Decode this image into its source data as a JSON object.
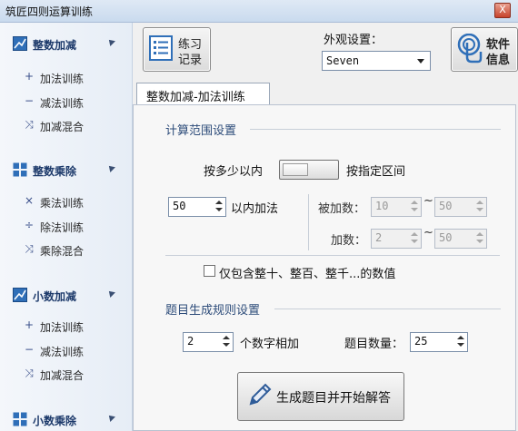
{
  "window": {
    "title": "筑匠四则运算训练",
    "close_label": "X"
  },
  "sidebar": {
    "groups": [
      {
        "label": "整数加减",
        "items": [
          {
            "icon": "plus-icon",
            "glyph": "+",
            "label": "加法训练"
          },
          {
            "icon": "minus-icon",
            "glyph": "−",
            "label": "减法训练"
          },
          {
            "icon": "shuffle-icon",
            "glyph": "⤨",
            "label": "加减混合"
          }
        ]
      },
      {
        "label": "整数乘除",
        "items": [
          {
            "icon": "multiply-icon",
            "glyph": "×",
            "label": "乘法训练"
          },
          {
            "icon": "divide-icon",
            "glyph": "÷",
            "label": "除法训练"
          },
          {
            "icon": "shuffle-icon",
            "glyph": "⤨",
            "label": "乘除混合"
          }
        ]
      },
      {
        "label": "小数加减",
        "items": [
          {
            "icon": "plus-icon",
            "glyph": "+",
            "label": "加法训练"
          },
          {
            "icon": "minus-icon",
            "glyph": "−",
            "label": "减法训练"
          },
          {
            "icon": "shuffle-icon",
            "glyph": "⤨",
            "label": "加减混合"
          }
        ]
      },
      {
        "label": "小数乘除",
        "items": []
      }
    ]
  },
  "toolbar": {
    "practice_record_line1": "练习",
    "practice_record_line2": "记录",
    "appearance_label": "外观设置：",
    "theme_value": "Seven",
    "software_info_line1": "软件",
    "software_info_line2": "信息"
  },
  "tab": {
    "label": "整数加减-加法训练"
  },
  "range": {
    "section_title": "计算范围设置",
    "mode_left_label": "按多少以内",
    "mode_right_label": "按指定区间",
    "within_value": "50",
    "within_label": "以内加法",
    "augend_label": "被加数：",
    "augend_min": "10",
    "augend_max": "50",
    "addend_label": "加数：",
    "addend_min": "2",
    "addend_max": "50",
    "range_sep": "~",
    "only_whole_label": "仅包含整十、整百、整千...的数值"
  },
  "rules": {
    "section_title": "题目生成规则设置",
    "digits_value": "2",
    "digits_label": "个数字相加",
    "count_label": "题目数量：",
    "count_value": "25"
  },
  "generate": {
    "label": "生成题目并开始解答"
  },
  "colors": {
    "accent": "#2d4c7a",
    "window_bg": "#f0f0f0"
  }
}
